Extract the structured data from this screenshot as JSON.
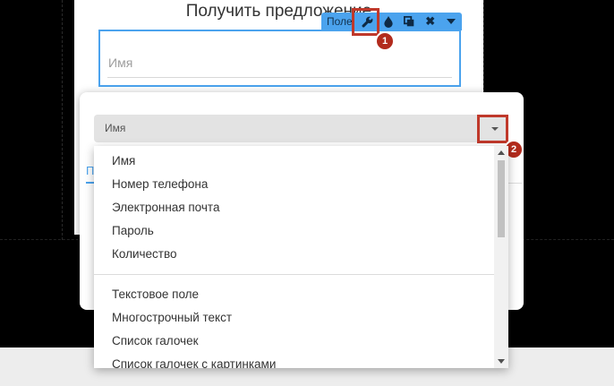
{
  "form": {
    "title": "Получить предложение",
    "field_placeholder": "Имя"
  },
  "toolbar": {
    "label": "Поле",
    "icons": [
      "wrench-icon",
      "drop-icon",
      "copy-icon",
      "close-icon",
      "caret-down-icon"
    ]
  },
  "settings": {
    "select_value": "Имя",
    "tab_fragment": "П"
  },
  "dropdown": {
    "group1": [
      "Имя",
      "Номер телефона",
      "Электронная почта",
      "Пароль",
      "Количество"
    ],
    "group2": [
      "Текстовое поле",
      "Многострочный текст",
      "Список галочек",
      "Список галочек с картинками"
    ]
  },
  "annotations": {
    "badge1": "1",
    "badge2": "2"
  },
  "colors": {
    "accent": "#4ba3ee",
    "highlight": "#c0392b"
  }
}
